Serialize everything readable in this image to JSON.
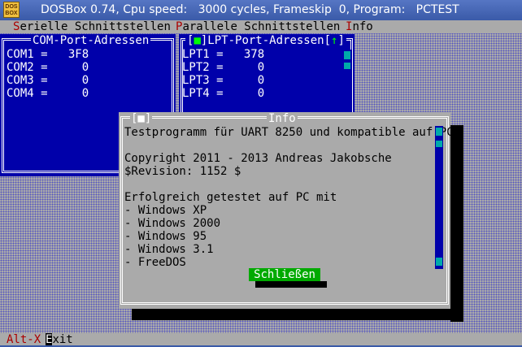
{
  "window": {
    "title": "DOSBox 0.74, Cpu speed:   3000 cycles, Frameskip  0, Program:   PCTEST",
    "icon_label": "DOS BOX"
  },
  "menu": [
    {
      "hot": "S",
      "rest": "erielle Schnittstellen"
    },
    {
      "hot": "P",
      "rest": "arallele Schnittstellen"
    },
    {
      "hot": "I",
      "rest": "nfo"
    }
  ],
  "com_window": {
    "title": "COM-Port-Adressen",
    "rows": [
      "COM1 =   3F8",
      "COM2 =     0",
      "COM3 =     0",
      "COM4 =     0"
    ]
  },
  "lpt_window": {
    "title_prefix": "[",
    "title_close": "■",
    "title_mid": "]LPT-Port-Adressen[",
    "title_zoom": "↑",
    "title_suffix": "]",
    "rows": [
      "LPT1 =   378",
      "LPT2 =     0",
      "LPT3 =     0",
      "LPT4 =     0"
    ]
  },
  "info_dialog": {
    "close_box": "[■]",
    "title": "Info",
    "lines": [
      "Testprogramm für UART 8250 und kompatible auf PC",
      "",
      "Copyright 2011 - 2013 Andreas Jakobsche",
      "$Revision: 1152 $",
      "",
      "Erfolgreich getestet auf PC mit",
      "- Windows XP",
      "- Windows 2000",
      "- Windows 95",
      "- Windows 3.1",
      "- FreeDOS"
    ],
    "button_label": "Schließen"
  },
  "statusbar": {
    "key": "Alt-X",
    "label_hot": "E",
    "label_rest": "xit"
  },
  "colors": {
    "dos_blue": "#0000aa",
    "dos_gray": "#aaaaaa",
    "dos_red": "#aa0000",
    "dos_green": "#00aa00",
    "dos_cyan": "#00aaaa",
    "titlebar": "#3a5aa8"
  }
}
